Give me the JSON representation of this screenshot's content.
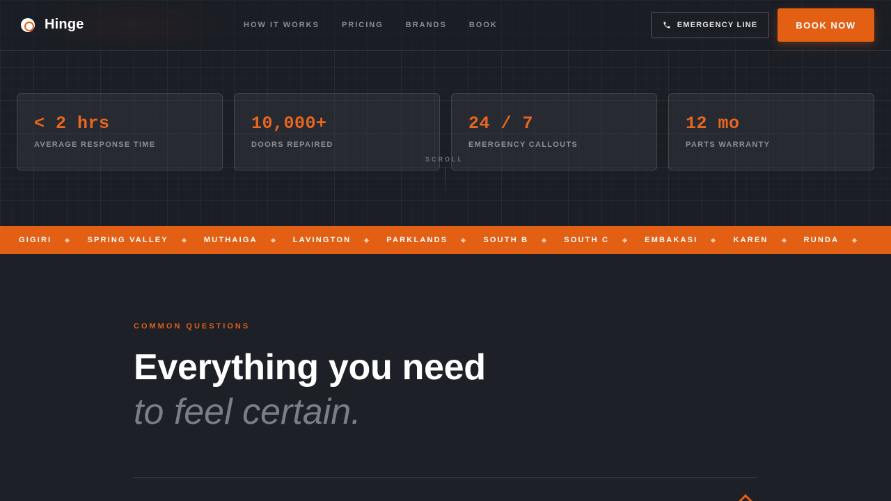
{
  "nav": {
    "brand": "Hinge",
    "links": [
      "HOW IT WORKS",
      "PRICING",
      "BRANDS",
      "BOOK"
    ],
    "emergency_label": "EMERGENCY LINE",
    "book_label": "BOOK NOW"
  },
  "stats": [
    {
      "value": "< 2 hrs",
      "label": "AVERAGE RESPONSE TIME"
    },
    {
      "value": "10,000+",
      "label": "DOORS REPAIRED"
    },
    {
      "value": "24 / 7",
      "label": "EMERGENCY CALLOUTS"
    },
    {
      "value": "12 mo",
      "label": "PARTS WARRANTY"
    }
  ],
  "scroll_hint": "SCROLL",
  "ticker": [
    "GIGIRI",
    "SPRING VALLEY",
    "MUTHAIGA",
    "LAVINGTON",
    "PARKLANDS",
    "SOUTH B",
    "SOUTH C",
    "EMBAKASI",
    "KAREN",
    "RUNDA"
  ],
  "faq": {
    "eyebrow": "COMMON QUESTIONS",
    "heading_line1": "Everything you need",
    "heading_line2": "to feel certain."
  },
  "colors": {
    "accent": "#e35f14",
    "background": "#1e2027"
  }
}
